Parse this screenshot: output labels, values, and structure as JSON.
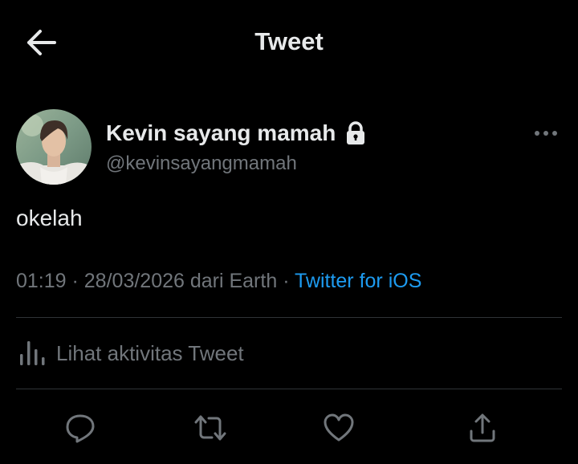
{
  "header": {
    "title": "Tweet",
    "back_icon": "arrow-left-icon"
  },
  "author": {
    "display_name": "Kevin sayang mamah",
    "handle": "@kevinsayangmamah",
    "protected_icon": "lock-icon",
    "more_icon": "more-horizontal-icon"
  },
  "tweet": {
    "text": "okelah",
    "time": "01:19",
    "separator_1": " · ",
    "date": "28/03/2026 dari Earth",
    "separator_2": " · ",
    "source": "Twitter for iOS"
  },
  "activity": {
    "label": "Lihat aktivitas Tweet",
    "icon": "bar-chart-icon"
  },
  "actions": {
    "reply_icon": "reply-icon",
    "retweet_icon": "retweet-icon",
    "like_icon": "heart-icon",
    "share_icon": "share-icon"
  },
  "colors": {
    "background": "#000000",
    "text_primary": "#e7e9ea",
    "text_secondary": "#71767b",
    "link": "#1d9bf0",
    "divider": "#2f3336"
  }
}
